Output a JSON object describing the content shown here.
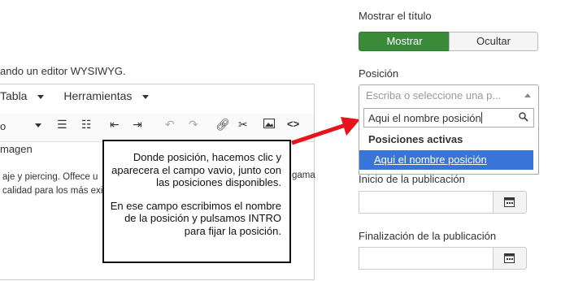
{
  "editor": {
    "intro": "ando un editor WYSIWYG.",
    "menu": [
      "Tabla",
      "Herramientas"
    ],
    "toolbar_left": "o",
    "image_label": "magen",
    "content_lines": [
      "aje y piercing. Offece u",
      "calidad para los más exig"
    ],
    "content_right": "gama"
  },
  "callout": {
    "para1": "Donde posición, hacemos clic y aparecera el campo vavio, junto con las posiciones disponibles.",
    "para2": "En ese campo escribimos el nombre de la posición y pulsamos INTRO para fijar la posición."
  },
  "sidebar": {
    "show_title_label": "Mostrar el título",
    "show_btn": "Mostrar",
    "hide_btn": "Ocultar",
    "position_label": "Posición",
    "position_placeholder": "Escriba o seleccione una p...",
    "search_value": "Aqui el nombre posición",
    "group_label": "Posiciones activas",
    "option_label": "Aqui el nombre posición",
    "publish_start_label": "Inicio de la publicación",
    "publish_end_label": "Finalización de la publicación"
  },
  "colors": {
    "accent_green": "#3a8a3a",
    "highlight_blue": "#3875d7",
    "arrow_red": "#e8121a"
  }
}
